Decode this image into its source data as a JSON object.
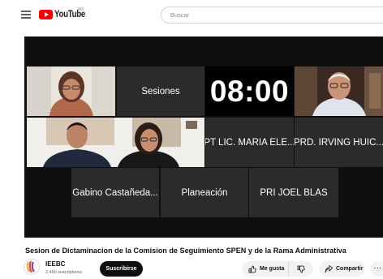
{
  "header": {
    "logo_text": "YouTube",
    "logo_country": "MX",
    "search_placeholder": "Buscar"
  },
  "video": {
    "tiles": {
      "sesiones": "Sesiones",
      "timer": "08:00",
      "maria": "PT LIC. MARIA ELE...",
      "irving": "PRD. IRVING HUIC...",
      "gabino": "Gabino Castañeda...",
      "planeacion": "Planeación",
      "joel": "PRI JOEL BLAS"
    }
  },
  "info": {
    "title": "Sesion de Dictaminacion de la Comision de Seguimiento SPEN y de la Rama Administrativa",
    "channel": "IEEBC",
    "subscribers": "2,460 suscriptores",
    "subscribe_label": "Suscribirse",
    "like_label": "Me gusta",
    "share_label": "Compartir",
    "more_label": "···"
  },
  "colors": {
    "brand_red": "#ff0000",
    "tile_bg": "#2b2b2b",
    "video_bg": "#0f0f0f",
    "subscribe_bg": "#0f0f0f",
    "pill_bg": "#f2f2f2"
  },
  "icons": [
    "menu-icon",
    "youtube-logo-icon",
    "like-icon",
    "dislike-icon",
    "share-icon",
    "channel-avatar"
  ]
}
